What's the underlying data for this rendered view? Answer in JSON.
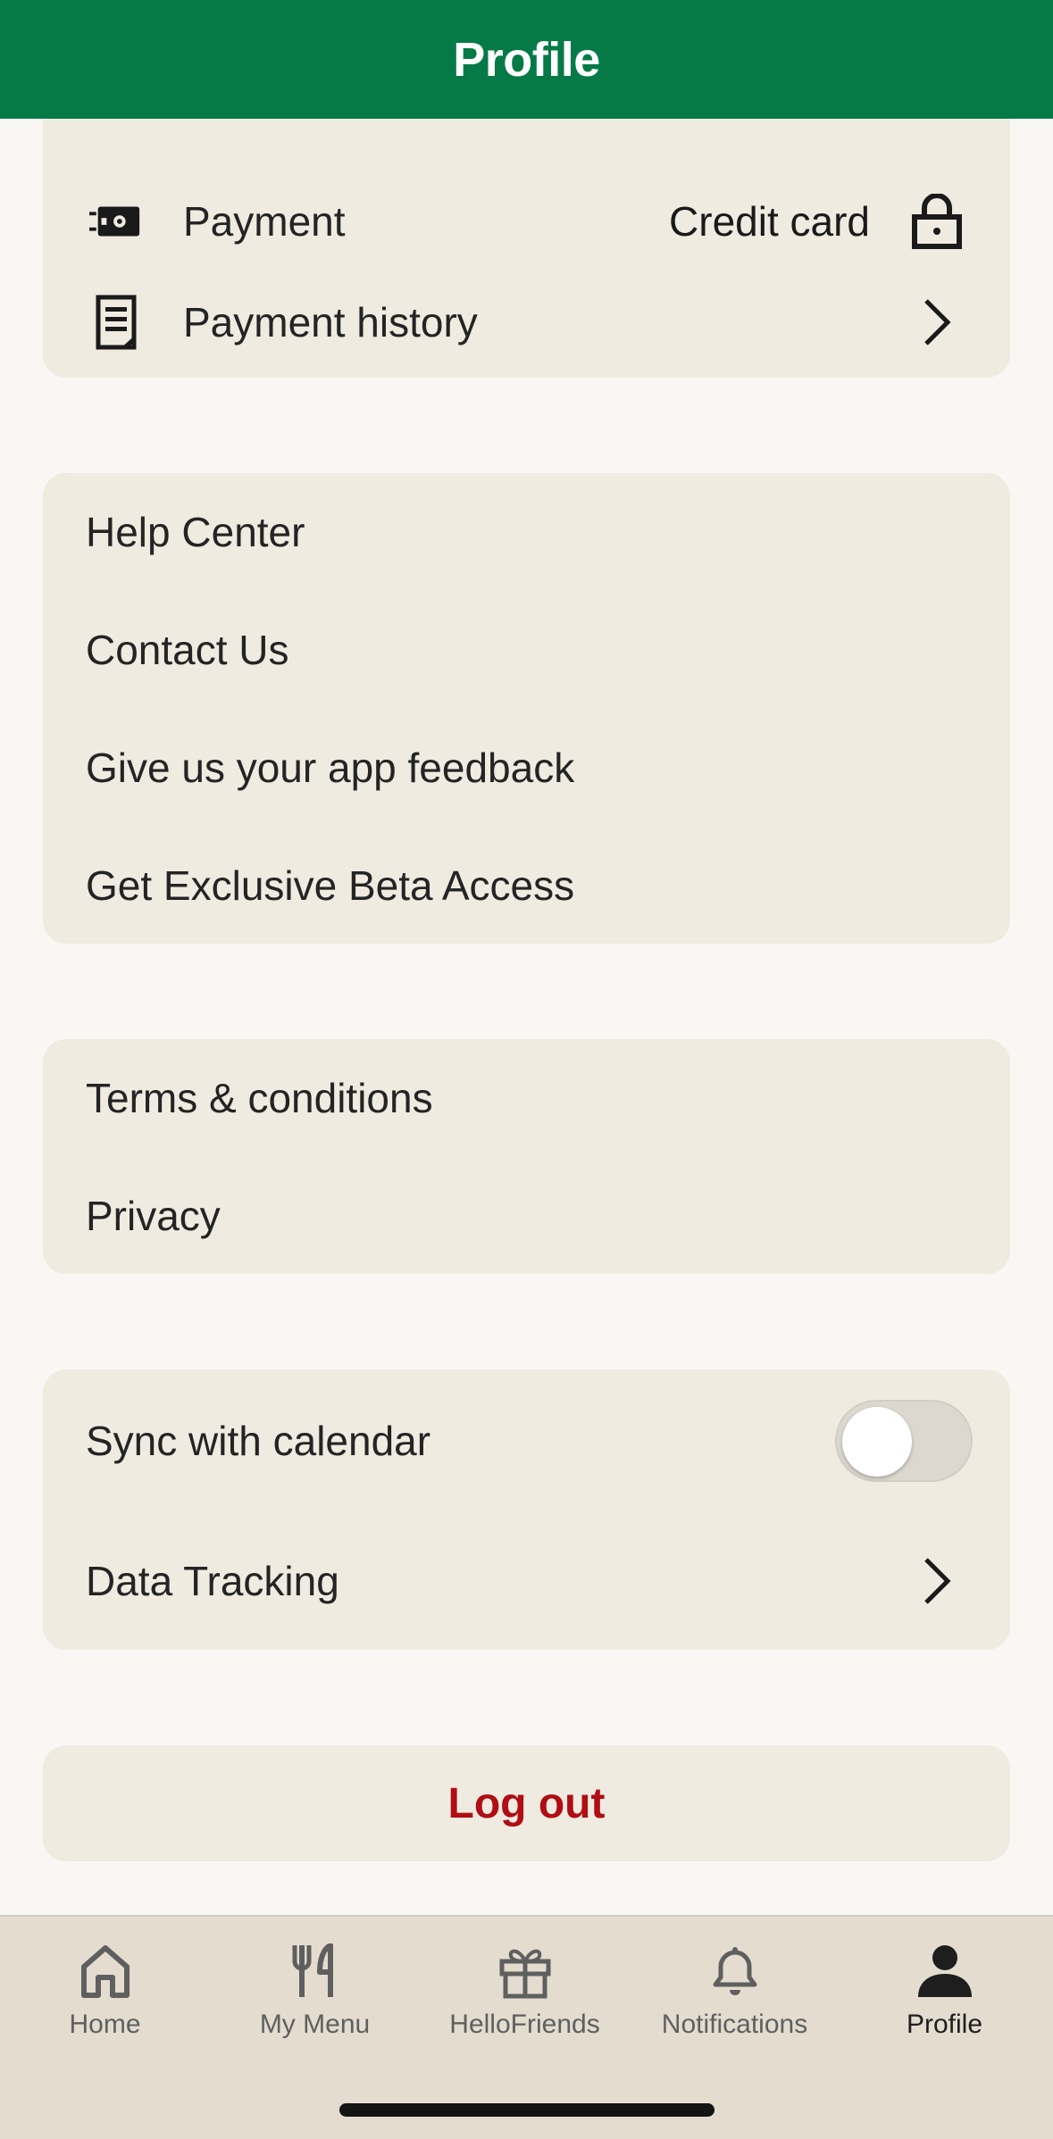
{
  "header": {
    "title": "Profile"
  },
  "payment_section": {
    "payment_label": "Payment",
    "payment_value": "Credit card",
    "history_label": "Payment history"
  },
  "help_section": {
    "items": [
      {
        "label": "Help Center"
      },
      {
        "label": "Contact Us"
      },
      {
        "label": "Give us your app feedback"
      },
      {
        "label": "Get Exclusive Beta Access"
      }
    ]
  },
  "legal_section": {
    "items": [
      {
        "label": "Terms & conditions"
      },
      {
        "label": "Privacy"
      }
    ]
  },
  "settings_section": {
    "sync_label": "Sync with calendar",
    "sync_enabled": false,
    "tracking_label": "Data Tracking"
  },
  "logout": {
    "label": "Log out"
  },
  "tabbar": {
    "items": [
      {
        "label": "Home",
        "icon": "home-icon"
      },
      {
        "label": "My Menu",
        "icon": "fork-knife-icon"
      },
      {
        "label": "HelloFriends",
        "icon": "gift-icon"
      },
      {
        "label": "Notifications",
        "icon": "bell-icon"
      },
      {
        "label": "Profile",
        "icon": "person-icon",
        "active": true
      }
    ]
  },
  "colors": {
    "brand_green": "#067a46",
    "card_bg": "#efebe0",
    "page_bg": "#f9f7f3",
    "logout_red": "#b00d14",
    "tabbar_bg": "#e3dccf"
  }
}
